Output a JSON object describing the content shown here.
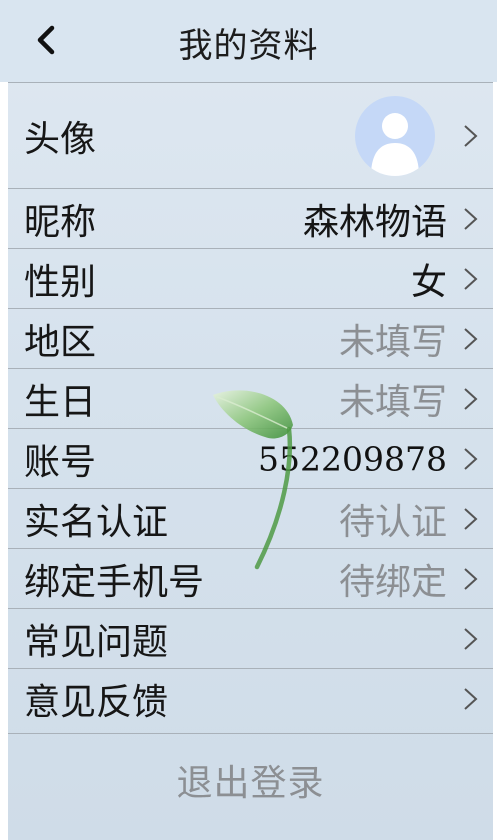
{
  "header": {
    "title": "我的资料",
    "back_icon": "chevron-left-icon"
  },
  "rows": [
    {
      "key": "avatar",
      "label": "头像"
    },
    {
      "key": "nickname",
      "label": "昵称",
      "value": "森林物语"
    },
    {
      "key": "gender",
      "label": "性别",
      "value": "女"
    },
    {
      "key": "region",
      "label": "地区",
      "value": "未填写"
    },
    {
      "key": "birthday",
      "label": "生日",
      "value": "未填写"
    },
    {
      "key": "account",
      "label": "账号",
      "value": "552209878"
    },
    {
      "key": "realname",
      "label": "实名认证",
      "value": "待认证"
    },
    {
      "key": "phone",
      "label": "绑定手机号",
      "value": "待绑定"
    },
    {
      "key": "faq",
      "label": "常见问题"
    },
    {
      "key": "feedback",
      "label": "意见反馈"
    }
  ],
  "logout_label": "退出登录",
  "colors": {
    "background": "#d6e2ed",
    "divider": "#a9b1b9",
    "muted_text": "#8c8f93",
    "avatar_bg": "#c5d8f7"
  }
}
